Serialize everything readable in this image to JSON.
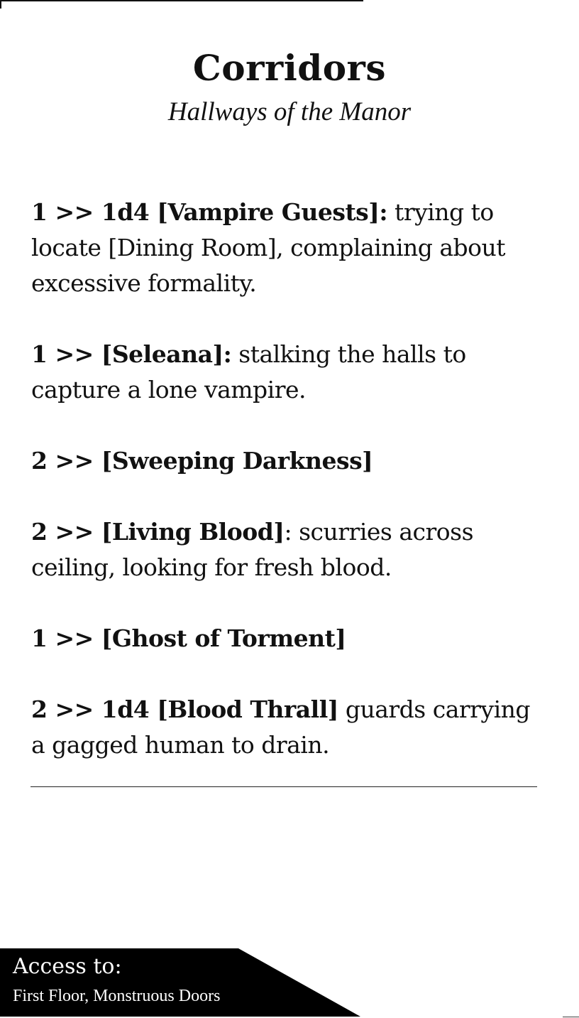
{
  "page": {
    "title": "Corridors",
    "subtitle": "Hallways of the Manor"
  },
  "entries": [
    {
      "lead": "1 >> 1d4 [Vampire Guests]:",
      "text": " trying to locate [Dining Room], complaining about excessive formality."
    },
    {
      "lead": "1 >> [Seleana]:",
      "text": " stalking the halls to capture a lone vampire."
    },
    {
      "lead": "2 >> [Sweeping Darkness]",
      "text": ""
    },
    {
      "lead": "2 >> [Living Blood]",
      "text": ": scurries across ceiling, looking for fresh blood."
    },
    {
      "lead": "1 >> [Ghost of Torment]",
      "text": ""
    },
    {
      "lead": "2 >> 1d4 [Blood Thrall]",
      "text": " guards carrying a gagged human to drain."
    }
  ],
  "access": {
    "label": "Access to:",
    "value": "First Floor, Monstruous Doors"
  },
  "colors": {
    "text": "#111111",
    "background": "#ffffff",
    "access_box": "#000000",
    "access_text": "#ffffff"
  }
}
